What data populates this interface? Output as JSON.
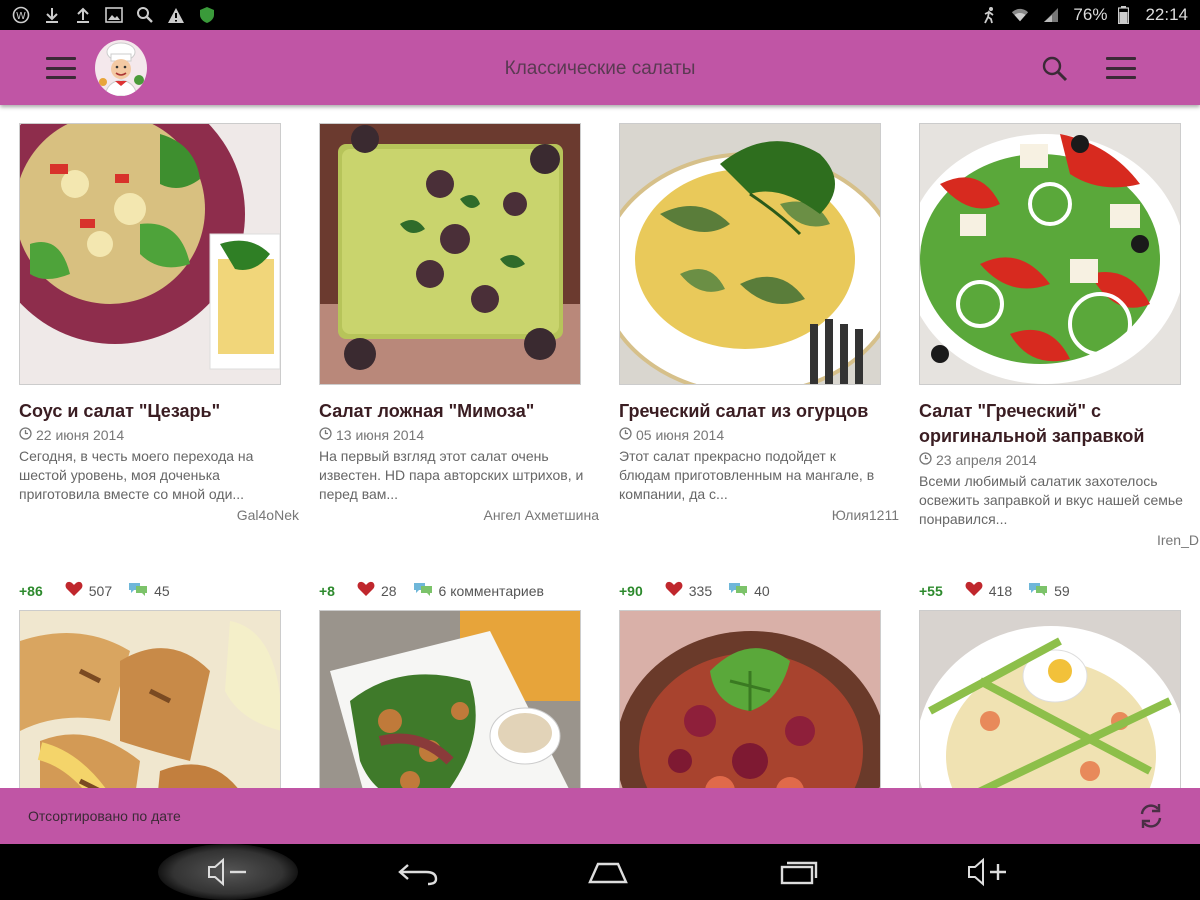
{
  "status_bar": {
    "battery": "76%",
    "time": "22:14"
  },
  "header": {
    "title": "Классические салаты"
  },
  "recipes": [
    {
      "title": "Соус и салат \"Цезарь\"",
      "date": "22 июня 2014",
      "description": "Сегодня, в честь моего перехода на шестой уровень, моя доченька приготовила вместе со мной оди...",
      "author": "Gal4oNek",
      "rating": "+86",
      "likes": "507",
      "comments": "45"
    },
    {
      "title": "Салат ложная \"Мимоза\"",
      "date": "13 июня 2014",
      "description": "На первый взгляд этот салат очень известен. HD пара авторских штрихов, и перед вам...",
      "author": "Ангел Ахметшина",
      "rating": "+8",
      "likes": "28",
      "comments": "6 комментариев"
    },
    {
      "title": "Греческий салат из огурцов",
      "date": "05 июня 2014",
      "description": "Этот салат прекрасно подойдет к блюдам приготовленным на мангале, в компании, да с...",
      "author": "Юлия1211",
      "rating": "+90",
      "likes": "335",
      "comments": "40"
    },
    {
      "title": "Салат \"Греческий\" с оригинальной заправкой",
      "date": "23 апреля 2014",
      "description": "Всеми любимый салатик захотелось освежить заправкой и вкус нашей семье понравился...",
      "author": "Iren_D",
      "rating": "+55",
      "likes": "418",
      "comments": "59"
    }
  ],
  "bottom_bar": {
    "sort_label": "Отсортировано по дате"
  },
  "icons": {
    "menu": "hamburger-icon",
    "logo": "chef-logo",
    "search": "search-icon",
    "overflow": "menu-icon",
    "clock": "clock-icon",
    "heart": "heart-icon",
    "comment": "comment-icon",
    "refresh": "refresh-icon",
    "volume_down": "volume-down-icon",
    "back": "back-icon",
    "home": "home-icon",
    "recents": "recents-icon",
    "volume_up": "volume-up-icon"
  },
  "colors": {
    "app_bar": "#c055a5",
    "rating": "#2d8a2d",
    "heart": "#c0272d",
    "title": "#3a1d22"
  }
}
